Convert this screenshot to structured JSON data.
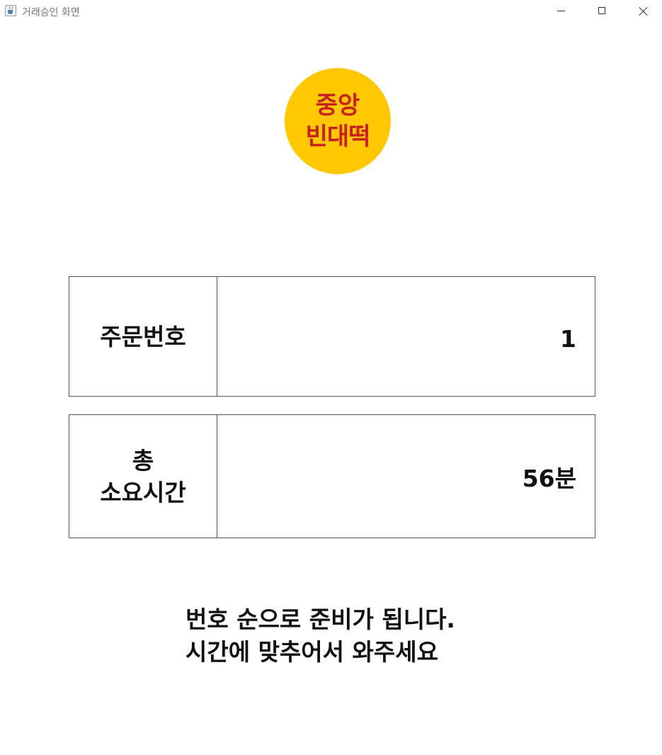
{
  "window": {
    "title": "거래승인 화면",
    "icon": "java-cup-icon",
    "controls": [
      "minimize",
      "maximize",
      "close"
    ]
  },
  "logo": {
    "line1": "중앙",
    "line2": "빈대떡",
    "background_color": "#ffc800",
    "text_color": "#c8201e"
  },
  "order_box": {
    "label": "주문번호",
    "value": "1"
  },
  "time_box": {
    "label_line1": "총",
    "label_line2": "소요시간",
    "value": "56분"
  },
  "notice": {
    "line1": "번호 순으로 준비가 됩니다.",
    "line2": "시간에 맞추어서 와주세요"
  }
}
